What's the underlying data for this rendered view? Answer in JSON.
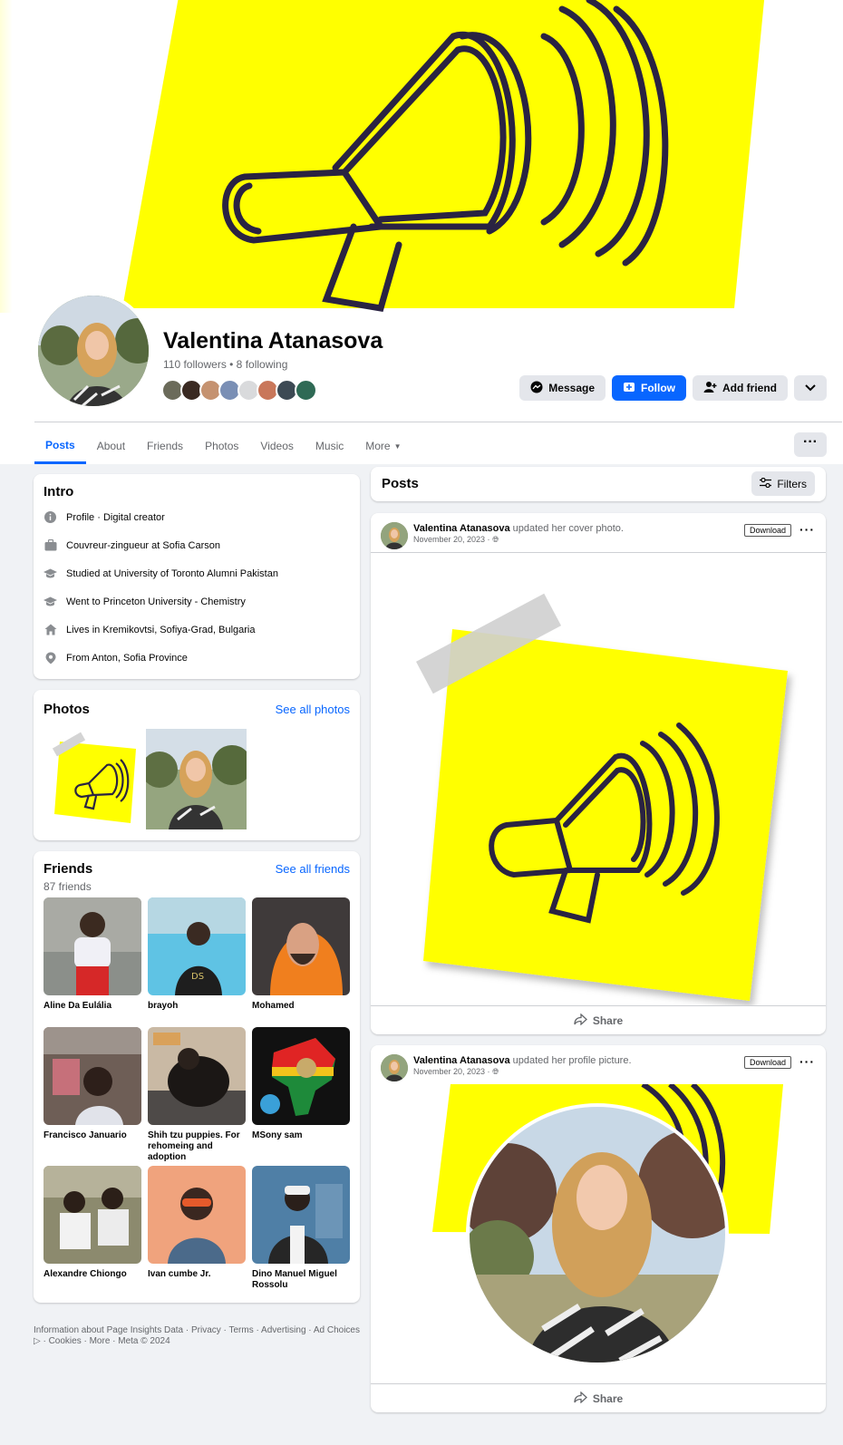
{
  "profile": {
    "name": "Valentina Atanasova",
    "stats": "110 followers • 8 following"
  },
  "colors": {
    "accent": "#0866ff",
    "cover_yellow": "#ffff00",
    "megaphone": "#2a2342"
  },
  "actions": {
    "message": "Message",
    "follow": "Follow",
    "add_friend": "Add friend"
  },
  "tabs": [
    {
      "label": "Posts"
    },
    {
      "label": "About"
    },
    {
      "label": "Friends"
    },
    {
      "label": "Photos"
    },
    {
      "label": "Videos"
    },
    {
      "label": "Music"
    },
    {
      "label": "More"
    }
  ],
  "intro": {
    "title": "Intro",
    "items": [
      {
        "icon": "info-icon",
        "text": "Profile · Digital creator"
      },
      {
        "icon": "briefcase-icon",
        "text": "Couvreur-zingueur at Sofia Carson"
      },
      {
        "icon": "graduation-cap-icon",
        "text": "Studied at University of Toronto Alumni Pakistan"
      },
      {
        "icon": "graduation-cap-icon",
        "text": "Went to Princeton University - Chemistry"
      },
      {
        "icon": "home-icon",
        "text": "Lives in Kremikovtsi, Sofiya-Grad, Bulgaria"
      },
      {
        "icon": "location-pin-icon",
        "text": "From Anton, Sofia Province"
      }
    ]
  },
  "photos": {
    "title": "Photos",
    "see_all": "See all photos"
  },
  "friends": {
    "title": "Friends",
    "count": "87 friends",
    "see_all": "See all friends",
    "items": [
      {
        "name": "Aline Da Eulália"
      },
      {
        "name": "brayoh"
      },
      {
        "name": "Mohamed"
      },
      {
        "name": "Francisco Januario"
      },
      {
        "name": "Shih tzu puppies. For rehomeing and adoption"
      },
      {
        "name": "MSony sam"
      },
      {
        "name": "Alexandre Chiongo"
      },
      {
        "name": "Ivan cumbe Jr."
      },
      {
        "name": "Dino Manuel Miguel Rossolu"
      }
    ]
  },
  "footer": {
    "text": "Information about Page Insights Data · Privacy · Terms · Advertising · Ad Choices ▷ · Cookies · More · Meta © 2024"
  },
  "posts_header": {
    "title": "Posts",
    "filters": "Filters"
  },
  "posts": [
    {
      "author": "Valentina Atanasova",
      "action": "updated her cover photo.",
      "date": "November 20, 2023 ·",
      "download": "Download",
      "share": "Share"
    },
    {
      "author": "Valentina Atanasova",
      "action": "updated her profile picture.",
      "date": "November 20, 2023 ·",
      "download": "Download",
      "share": "Share"
    }
  ]
}
